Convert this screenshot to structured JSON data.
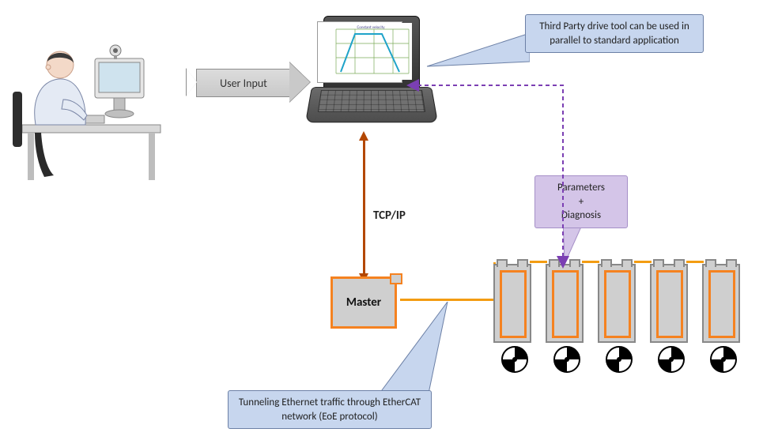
{
  "labels": {
    "user_input": "User Input",
    "tcpip": "TCP/IP",
    "master": "Master"
  },
  "callouts": {
    "third_party": "Third Party drive tool can be used in parallel to standard application",
    "params_diag_line1": "Parameters",
    "params_diag_plus": "+",
    "params_diag_line2": "Diagnosis",
    "tunneling": "Tunneling Ethernet traffic through EtherCAT network (EoE protocol)"
  },
  "chart_screen": {
    "top_label": "Constant velocity"
  },
  "colors": {
    "accent_orange": "#f58220",
    "callout_blue": "#c7d6ee",
    "callout_purple": "#d4c5e8",
    "tcpip_line": "#b34700",
    "dashed_purple": "#7b3fb3"
  },
  "slave_count": 5
}
